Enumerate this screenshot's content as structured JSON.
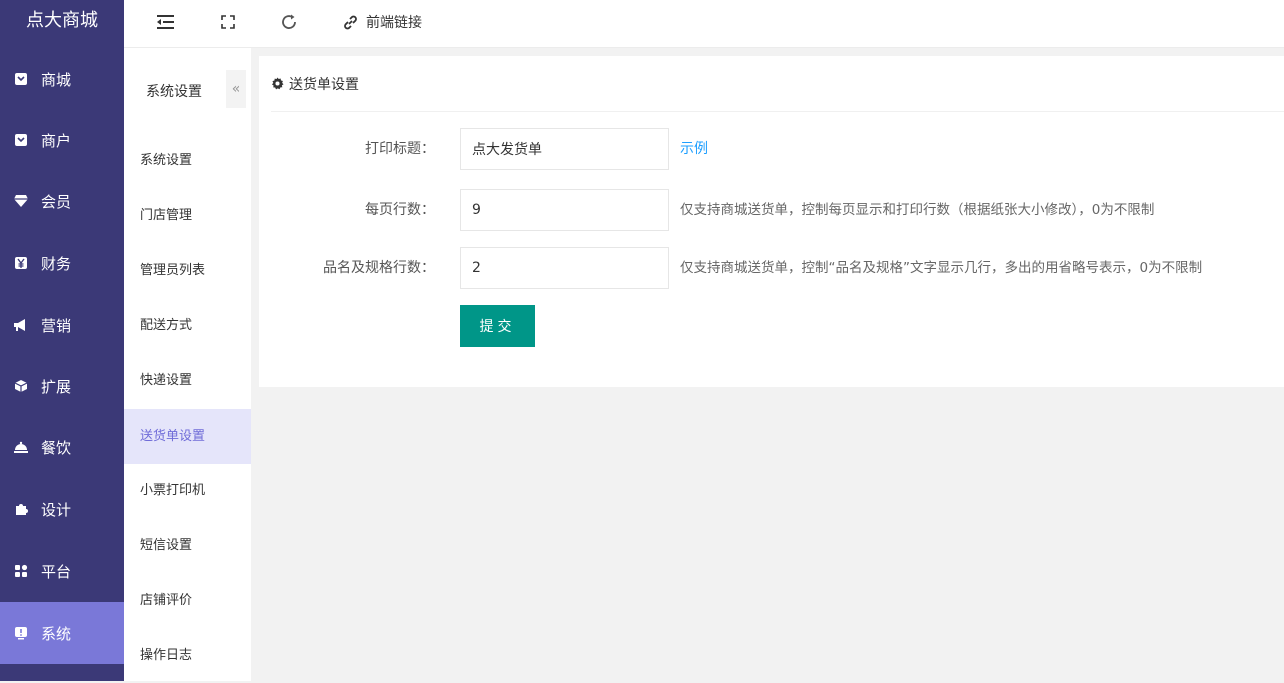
{
  "brand": "点大商城",
  "sidebar": {
    "items": [
      {
        "label": "商城",
        "icon": "shop-bag-icon"
      },
      {
        "label": "商户",
        "icon": "merchant-bag-icon"
      },
      {
        "label": "会员",
        "icon": "diamond-icon"
      },
      {
        "label": "财务",
        "icon": "yen-icon"
      },
      {
        "label": "营销",
        "icon": "megaphone-icon"
      },
      {
        "label": "扩展",
        "icon": "cube-icon"
      },
      {
        "label": "餐饮",
        "icon": "dining-cover-icon"
      },
      {
        "label": "设计",
        "icon": "puzzle-icon"
      },
      {
        "label": "平台",
        "icon": "grid-apps-icon"
      },
      {
        "label": "系统",
        "icon": "system-monitor-icon",
        "active": true
      }
    ]
  },
  "topbar": {
    "link_label": "前端链接"
  },
  "subnav": {
    "title": "系统设置",
    "collapse_glyph": "«",
    "items": [
      {
        "label": "系统设置"
      },
      {
        "label": "门店管理"
      },
      {
        "label": "管理员列表"
      },
      {
        "label": "配送方式"
      },
      {
        "label": "快递设置"
      },
      {
        "label": "送货单设置",
        "active": true
      },
      {
        "label": "小票打印机"
      },
      {
        "label": "短信设置"
      },
      {
        "label": "店铺评价"
      },
      {
        "label": "操作日志"
      }
    ]
  },
  "panel": {
    "title": "送货单设置",
    "rows": [
      {
        "label": "打印标题：",
        "value": "点大发货单",
        "hint": "示例"
      },
      {
        "label": "每页行数：",
        "value": "9",
        "hint": "仅支持商城送货单，控制每页显示和打印行数（根据纸张大小修改），0为不限制"
      },
      {
        "label": "品名及规格行数：",
        "value": "2",
        "hint": "仅支持商城送货单，控制“品名及规格”文字显示几行，多出的用省略号表示，0为不限制"
      }
    ],
    "submit_label": "提交"
  },
  "colors": {
    "sidebar_bg": "#3b3977",
    "sidebar_active": "#7a78d8",
    "submit": "#009688",
    "link": "#1e9fff",
    "subnav_active_bg": "#e5e5fa"
  }
}
